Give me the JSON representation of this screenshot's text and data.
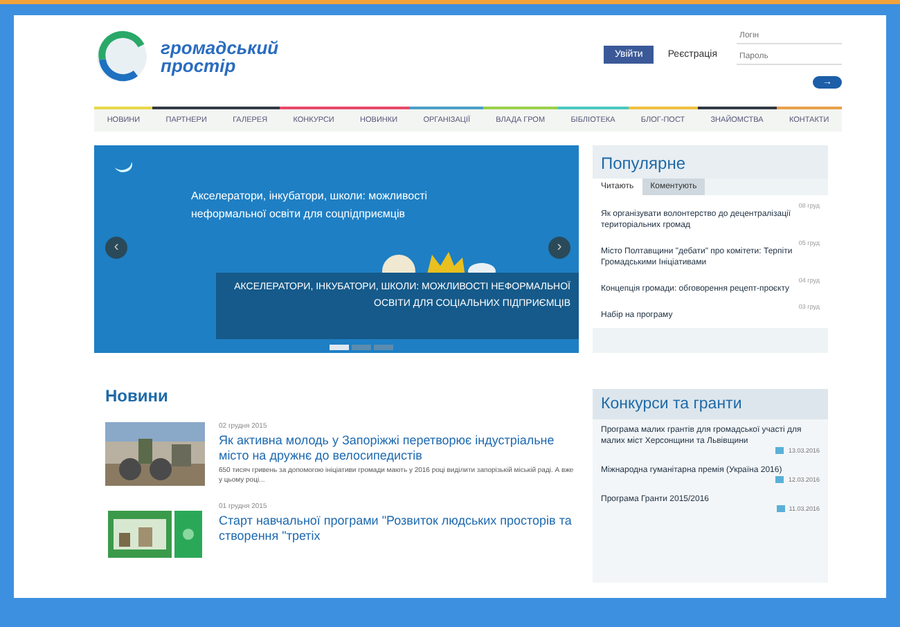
{
  "logo": {
    "line1": "громадський",
    "line2": "простір"
  },
  "header": {
    "facebook_button": "Увійти",
    "register_link": "Реєстрація",
    "login": {
      "placeholder": "Логін"
    },
    "password": {
      "placeholder": "Пароль"
    },
    "submit": "→"
  },
  "nav": [
    {
      "label": "НОВИНИ",
      "color": "#e8d84a"
    },
    {
      "label": "ПАРТНЕРИ",
      "color": "#333a44"
    },
    {
      "label": "ГАЛЕРЕЯ",
      "color": "#333a44"
    },
    {
      "label": "КОНКУРСИ",
      "color": "#e84a6a"
    },
    {
      "label": "НОВИНКИ",
      "color": "#e84a6a"
    },
    {
      "label": "ОРГАНІЗАЦІЇ",
      "color": "#4aa0c8"
    },
    {
      "label": "ВЛАДА ГРОМ",
      "color": "#9ad04a"
    },
    {
      "label": "БІБЛІОТЕКА",
      "color": "#4ac8c0"
    },
    {
      "label": "БЛОГ-ПОСТ",
      "color": "#f0c040"
    },
    {
      "label": "ЗНАЙОМСТВА",
      "color": "#333a44"
    },
    {
      "label": "КОНТАКТИ",
      "color": "#e8a04a"
    }
  ],
  "slider": {
    "headline": "Акселератори, інкубатори, школи: можливості неформальної освіти для соцпідприємців",
    "caption": "АКСЕЛЕРАТОРИ, ІНКУБАТОРИ, ШКОЛИ: МОЖЛИВОСТІ НЕФОРМАЛЬНОЇ ОСВІТИ ДЛЯ СОЦІАЛЬНИХ ПІДПРИЄМЦІВ",
    "prev": "‹",
    "next": "›",
    "dots": [
      {
        "selected": true
      },
      {
        "selected": false
      },
      {
        "selected": false
      }
    ]
  },
  "popular": {
    "title": "Популярне",
    "tabs": [
      {
        "label": "Читають",
        "selected": true
      },
      {
        "label": "Коментують",
        "selected": false
      }
    ],
    "items": [
      {
        "date": "08 груд",
        "text": "Як організувати волонтерство до децентралізації територіальних громад"
      },
      {
        "date": "05 груд",
        "text": "Місто Полтавщини \"дебати\" про комітети: Терпіти Громадськими Ініціативами"
      },
      {
        "date": "04 груд",
        "text": "Концепція громади: обговорення рецепт-проєкту"
      },
      {
        "date": "03 груд",
        "text": "Набір на програму"
      }
    ]
  },
  "news": {
    "title": "Новини",
    "items": [
      {
        "date": "02 грудня 2015",
        "title": "Як активна молодь у Запоріжжі перетворює індустріальне місто на дружнє до велосипедистів",
        "excerpt": "650 тисяч гривень за допомогою ініціативи громади мають у 2016 році виділити запорізькій міській раді. А вже у цьому році...",
        "kind": "bikes"
      },
      {
        "date": "01 грудня 2015",
        "title": "Старт навчальної програми \"Розвиток людських просторів та створення \"третіх",
        "kind": "green"
      }
    ]
  },
  "grants": {
    "title": "Конкурси та гранти",
    "items": [
      {
        "text": "Програма малих грантів для громадської участі для малих міст Херсонщини та Львівщини",
        "date": "13.03.2016"
      },
      {
        "text": "Міжнародна гуманітарна премія (Україна 2016)",
        "date": "12.03.2016"
      },
      {
        "text": "Програма Гранти 2015/2016",
        "date": "11.03.2016"
      }
    ]
  }
}
